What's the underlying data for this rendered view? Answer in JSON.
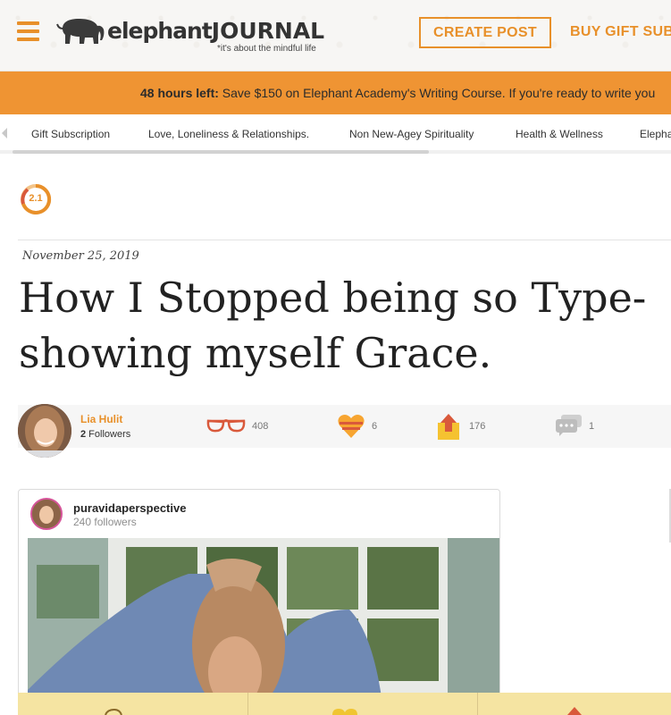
{
  "header": {
    "logo_word": "elephant",
    "logo_word2": "JOURNAL",
    "logo_tagline": "*it's about the mindful life",
    "create_post_label": "CREATE POST",
    "buy_gift_label": "BUY GIFT SUB"
  },
  "promo": {
    "bold": "48 hours left:",
    "text": " Save $150 on Elephant Academy's Writing Course. If you're ready to write you"
  },
  "categories": [
    "Gift Subscription",
    "Love, Loneliness & Relationships.",
    "Non New-Agey Spirituality",
    "Health & Wellness",
    "Elephan"
  ],
  "article": {
    "rating": "2.1",
    "date": "November 25, 2019",
    "title_line1": "How I Stopped being so Type-",
    "title_line2": "showing myself Grace."
  },
  "author": {
    "name": "Lia Hulit",
    "followers_count": "2",
    "followers_label": " Followers"
  },
  "stats": {
    "reads": "408",
    "hearts": "6",
    "shares": "176",
    "comments": "1"
  },
  "embed": {
    "username": "puravidaperspective",
    "followers": "240 followers"
  },
  "colors": {
    "accent": "#e8902a",
    "promo_bg": "#ef9433",
    "bottom_bar": "#f5e4a2"
  }
}
